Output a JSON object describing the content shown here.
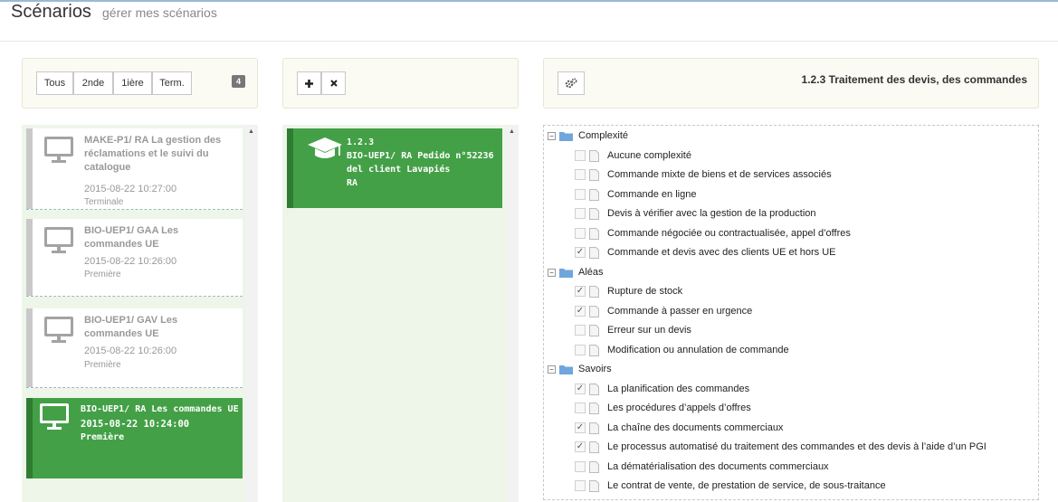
{
  "header": {
    "title": "Scénarios",
    "subtitle": "gérer mes scénarios"
  },
  "filters": {
    "buttons": [
      "Tous",
      "2nde",
      "1ière",
      "Term."
    ],
    "count": "4"
  },
  "scenarios": [
    {
      "title": "MAKE-P1/ RA La gestion des réclamations et le suivi du catalogue",
      "date": "2015-08-22 10:27:00",
      "level": "Terminale",
      "active": false
    },
    {
      "title": "BIO-UEP1/ GAA Les commandes UE",
      "date": "2015-08-22 10:26:00",
      "level": "Première",
      "active": false
    },
    {
      "title": "BIO-UEP1/ GAV Les commandes UE",
      "date": "2015-08-22 10:26:00",
      "level": "Première",
      "active": false
    },
    {
      "title": "BIO-UEP1/ RA Les commandes UE",
      "date": "2015-08-22 10:24:00",
      "level": "Première",
      "active": true
    }
  ],
  "middle": {
    "add_icon": "plus-icon",
    "delete_icon": "close-icon",
    "card": {
      "code": "1.2.3",
      "line1": "BIO-UEP1/ RA Pedido n°52236",
      "line2": "del client Lavapiés",
      "line3": "RA"
    }
  },
  "detail": {
    "settings_icon": "gears-icon",
    "heading": "1.2.3 Traitement des devis, des commandes"
  },
  "tree": [
    {
      "label": "Complexité",
      "items": [
        {
          "label": "Aucune complexité",
          "checked": false
        },
        {
          "label": "Commande mixte de biens et de services associés",
          "checked": false
        },
        {
          "label": "Commande en ligne",
          "checked": false
        },
        {
          "label": "Devis à vérifier avec la gestion de la production",
          "checked": false
        },
        {
          "label": "Commande négociée ou contractualisée, appel d’offres",
          "checked": false
        },
        {
          "label": "Commande et devis avec des clients UE et hors UE",
          "checked": true
        }
      ]
    },
    {
      "label": "Aléas",
      "items": [
        {
          "label": "Rupture de stock",
          "checked": true
        },
        {
          "label": "Commande à passer en urgence",
          "checked": true
        },
        {
          "label": "Erreur sur un devis",
          "checked": false
        },
        {
          "label": "Modification ou annulation de commande",
          "checked": false
        }
      ]
    },
    {
      "label": "Savoirs",
      "items": [
        {
          "label": "La planification des commandes",
          "checked": true
        },
        {
          "label": "Les procédures d’appels d’offres",
          "checked": false
        },
        {
          "label": "La chaîne des documents commerciaux",
          "checked": true
        },
        {
          "label": "Le processus automatisé du traitement des commandes et des devis à l’aide d’un PGI",
          "checked": true
        },
        {
          "label": "La dématérialisation des documents commerciaux",
          "checked": false
        },
        {
          "label": "Le contrat de vente, de prestation de service, de sous-traitance",
          "checked": false
        }
      ]
    }
  ],
  "colors": {
    "active_green": "#43a047",
    "list_bg": "#eef5e9",
    "panel_bg": "#fbfbf3",
    "folder_blue": "#6fa6dc"
  }
}
